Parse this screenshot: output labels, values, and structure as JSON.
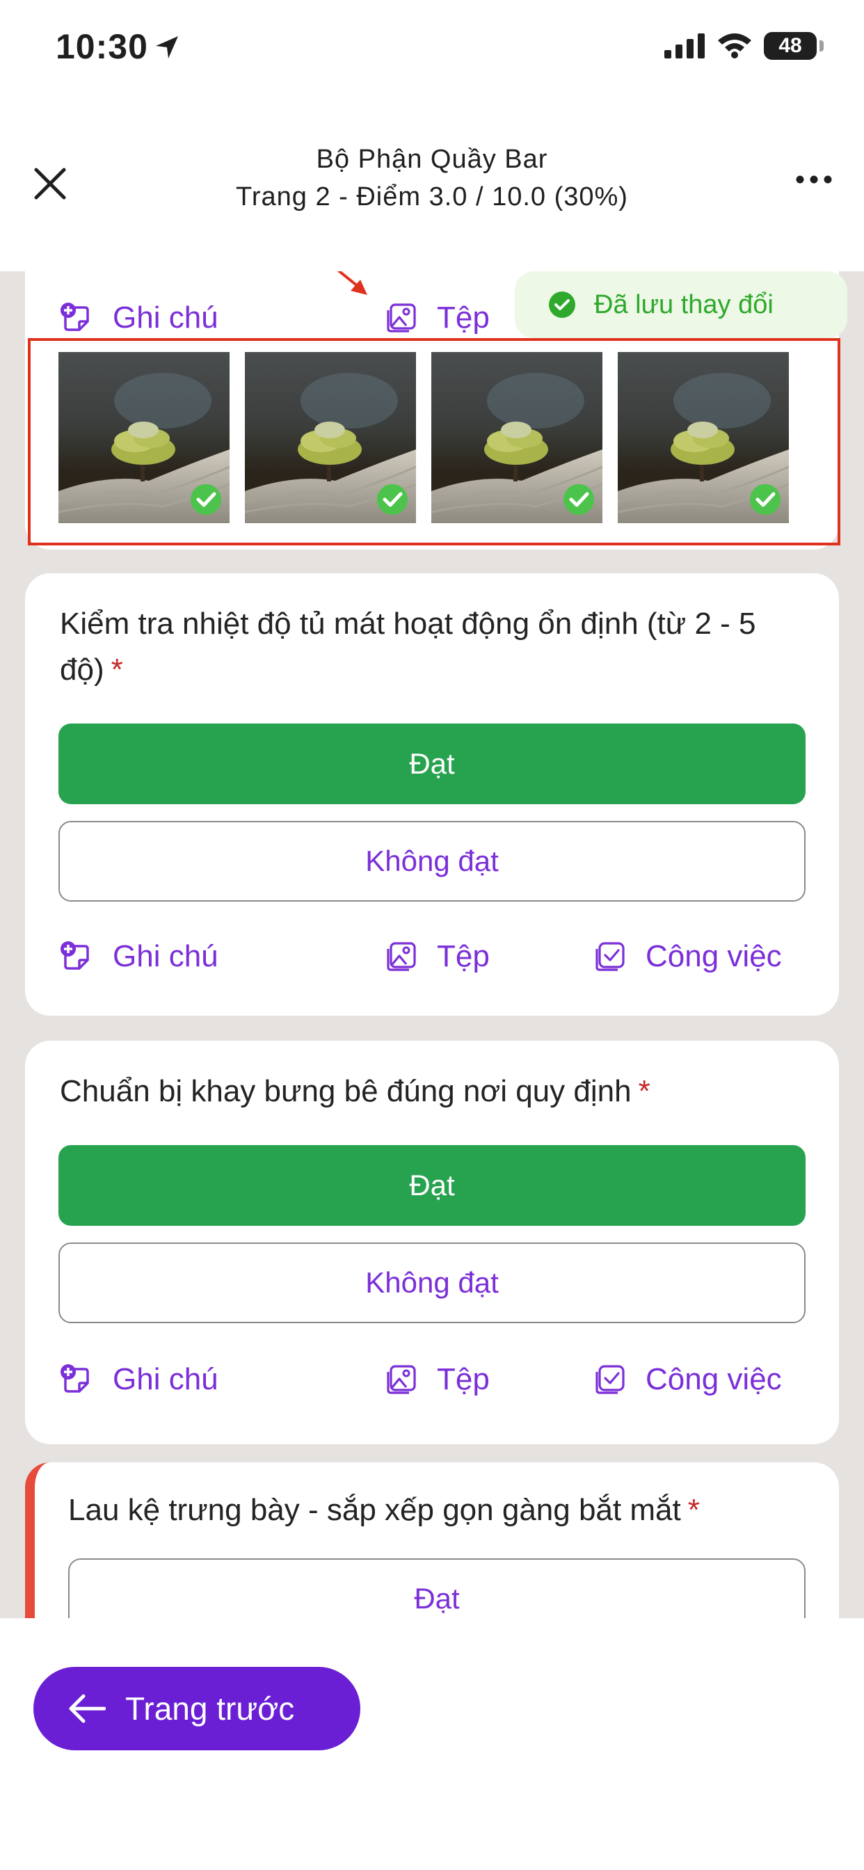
{
  "status_bar": {
    "time": "10:30",
    "battery": "48"
  },
  "header": {
    "title": "Bộ Phận Quầy Bar",
    "subtitle": "Trang 2 - Điểm 3.0 / 10.0 (30%)"
  },
  "toast": {
    "text": "Đã lưu thay đổi"
  },
  "top_card": {
    "actions": {
      "note": "Ghi chú",
      "file": "Tệp"
    },
    "thumbnails": [
      "tree-photo",
      "tree-photo",
      "tree-photo",
      "tree-photo"
    ]
  },
  "questions": [
    {
      "text": "Kiểm tra nhiệt độ tủ mát hoạt động ổn định (từ 2 - 5 độ)",
      "required_mark": "*",
      "pass_label": "Đạt",
      "fail_label": "Không đạt",
      "selected": "Đạt",
      "actions": {
        "note": "Ghi chú",
        "file": "Tệp",
        "task": "Công việc"
      }
    },
    {
      "text": "Chuẩn bị khay bưng bê đúng nơi quy định",
      "required_mark": "*",
      "pass_label": "Đạt",
      "fail_label": "Không đạt",
      "selected": "Đạt",
      "actions": {
        "note": "Ghi chú",
        "file": "Tệp",
        "task": "Công việc"
      }
    },
    {
      "text": "Lau kệ trưng bày - sắp xếp gọn gàng bắt mắt",
      "required_mark": "*",
      "pass_label": "Đạt",
      "selected": ""
    }
  ],
  "footer": {
    "prev_label": "Trang trước"
  },
  "colors": {
    "accent": "#7b2fd8",
    "primary_button": "#6a1fd4",
    "pass_selected": "#27a24f",
    "saved_bg": "#edf8e6",
    "saved_text": "#2fa82c",
    "error_border": "#e64a3b",
    "annotation": "#e0311d"
  }
}
